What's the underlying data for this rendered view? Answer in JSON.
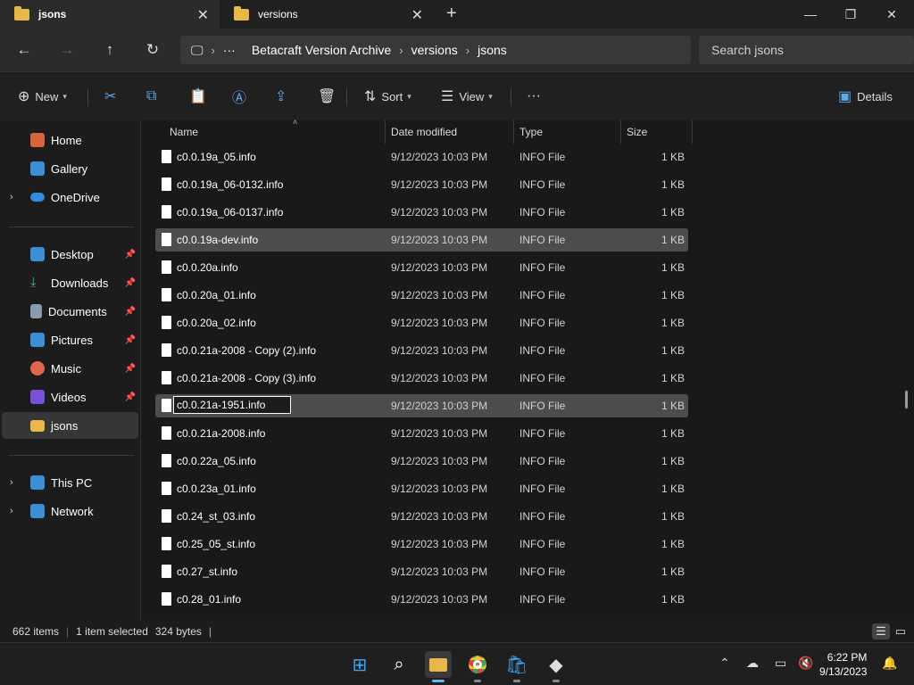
{
  "tabs": [
    {
      "label": "jsons",
      "active": true
    },
    {
      "label": "versions",
      "active": false
    }
  ],
  "window": {
    "minimize_icon": "minimize-icon",
    "maximize_icon": "restore-icon",
    "close_icon": "close-icon"
  },
  "breadcrumb": {
    "overflow": "···",
    "segments": [
      "Betacraft Version Archive",
      "versions",
      "jsons"
    ]
  },
  "search": {
    "placeholder": "Search jsons"
  },
  "toolbar": {
    "new_label": "New",
    "sort_label": "Sort",
    "view_label": "View",
    "more_label": "···",
    "details_label": "Details"
  },
  "sidebar": {
    "top": [
      {
        "label": "Home",
        "icon": "home-icon",
        "color": "#d9633b"
      },
      {
        "label": "Gallery",
        "icon": "gallery-icon",
        "color": "#3b8fd9"
      },
      {
        "label": "OneDrive",
        "icon": "onedrive-icon",
        "color": "#2f8de4"
      }
    ],
    "quick_access": [
      {
        "label": "Desktop",
        "icon": "desktop-icon",
        "color": "#3b8fd9"
      },
      {
        "label": "Downloads",
        "icon": "downloads-icon",
        "color": "#3cb371"
      },
      {
        "label": "Documents",
        "icon": "documents-icon",
        "color": "#8a9bb0"
      },
      {
        "label": "Pictures",
        "icon": "pictures-icon",
        "color": "#3b8fd9"
      },
      {
        "label": "Music",
        "icon": "music-icon",
        "color": "#e0654f"
      },
      {
        "label": "Videos",
        "icon": "videos-icon",
        "color": "#7a4fd9"
      },
      {
        "label": "jsons",
        "icon": "folder-icon",
        "color": "#e8b74a"
      }
    ],
    "bottom": [
      {
        "label": "This PC",
        "icon": "pc-icon",
        "color": "#3b8fd9"
      },
      {
        "label": "Network",
        "icon": "network-icon",
        "color": "#3b8fd9"
      }
    ]
  },
  "columns": {
    "name": "Name",
    "date": "Date modified",
    "type": "Type",
    "size": "Size"
  },
  "files": [
    {
      "name": "c0.0.19a_05.info",
      "date": "9/12/2023 10:03 PM",
      "type": "INFO File",
      "size": "1 KB",
      "state": ""
    },
    {
      "name": "c0.0.19a_06-0132.info",
      "date": "9/12/2023 10:03 PM",
      "type": "INFO File",
      "size": "1 KB",
      "state": ""
    },
    {
      "name": "c0.0.19a_06-0137.info",
      "date": "9/12/2023 10:03 PM",
      "type": "INFO File",
      "size": "1 KB",
      "state": ""
    },
    {
      "name": "c0.0.19a-dev.info",
      "date": "9/12/2023 10:03 PM",
      "type": "INFO File",
      "size": "1 KB",
      "state": "hover"
    },
    {
      "name": "c0.0.20a.info",
      "date": "9/12/2023 10:03 PM",
      "type": "INFO File",
      "size": "1 KB",
      "state": ""
    },
    {
      "name": "c0.0.20a_01.info",
      "date": "9/12/2023 10:03 PM",
      "type": "INFO File",
      "size": "1 KB",
      "state": ""
    },
    {
      "name": "c0.0.20a_02.info",
      "date": "9/12/2023 10:03 PM",
      "type": "INFO File",
      "size": "1 KB",
      "state": ""
    },
    {
      "name": "c0.0.21a-2008 - Copy (2).info",
      "date": "9/12/2023 10:03 PM",
      "type": "INFO File",
      "size": "1 KB",
      "state": ""
    },
    {
      "name": "c0.0.21a-2008 - Copy (3).info",
      "date": "9/12/2023 10:03 PM",
      "type": "INFO File",
      "size": "1 KB",
      "state": ""
    },
    {
      "name": "c0.0.21a-1951.info",
      "date": "9/12/2023 10:03 PM",
      "type": "INFO File",
      "size": "1 KB",
      "state": "renaming"
    },
    {
      "name": "c0.0.21a-2008.info",
      "date": "9/12/2023 10:03 PM",
      "type": "INFO File",
      "size": "1 KB",
      "state": ""
    },
    {
      "name": "c0.0.22a_05.info",
      "date": "9/12/2023 10:03 PM",
      "type": "INFO File",
      "size": "1 KB",
      "state": ""
    },
    {
      "name": "c0.0.23a_01.info",
      "date": "9/12/2023 10:03 PM",
      "type": "INFO File",
      "size": "1 KB",
      "state": ""
    },
    {
      "name": "c0.24_st_03.info",
      "date": "9/12/2023 10:03 PM",
      "type": "INFO File",
      "size": "1 KB",
      "state": ""
    },
    {
      "name": "c0.25_05_st.info",
      "date": "9/12/2023 10:03 PM",
      "type": "INFO File",
      "size": "1 KB",
      "state": ""
    },
    {
      "name": "c0.27_st.info",
      "date": "9/12/2023 10:03 PM",
      "type": "INFO File",
      "size": "1 KB",
      "state": ""
    },
    {
      "name": "c0.28_01.info",
      "date": "9/12/2023 10:03 PM",
      "type": "INFO File",
      "size": "1 KB",
      "state": ""
    }
  ],
  "status": {
    "items": "662 items",
    "selection": "1 item selected",
    "size": "324 bytes"
  },
  "taskbar": {
    "time": "6:22 PM",
    "date": "9/13/2023"
  },
  "colors": {
    "accent": "#60b6f0",
    "folder": "#e8b74a",
    "selection": "#4d4d4d"
  }
}
